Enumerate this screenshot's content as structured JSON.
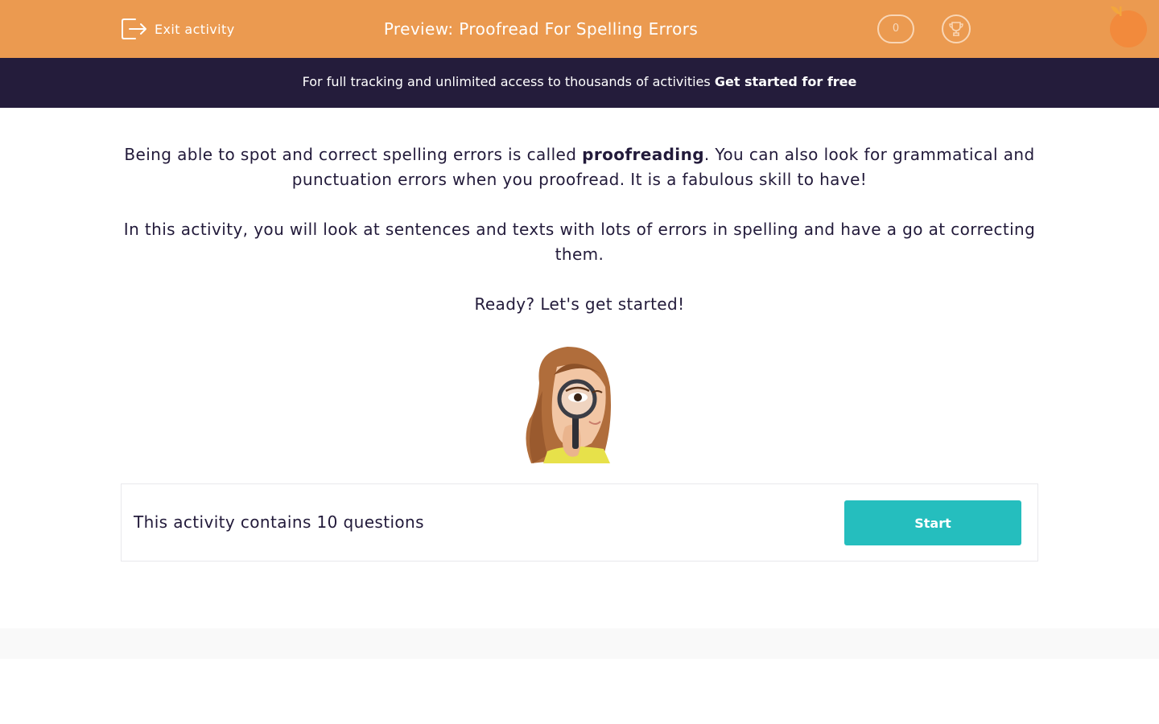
{
  "header": {
    "exit_label": "Exit activity",
    "title": "Preview: Proofread For Spelling Errors",
    "score": "0",
    "colors": {
      "bar": "#eb9a50",
      "text": "#ffffff"
    },
    "icons": [
      "exit-icon",
      "trophy-icon",
      "orange-logo"
    ]
  },
  "banner": {
    "text": "For full tracking and unlimited access to thousands of activities ",
    "cta": "Get started for free",
    "color": "#241c3b"
  },
  "intro": {
    "p1_before": "Being able to spot and correct spelling errors is called ",
    "p1_bold": "proofreading",
    "p1_after": ". You can also look for grammatical and punctuation errors when you proofread. It is a fabulous skill to have!",
    "p2": "In this activity, you will look at sentences and texts with lots of errors in spelling and have a go at correcting them.",
    "p3": "Ready? Let's get started!"
  },
  "activity": {
    "question_count_text": "This activity contains 10 questions",
    "start_label": "Start",
    "button_color": "#25bebe"
  }
}
